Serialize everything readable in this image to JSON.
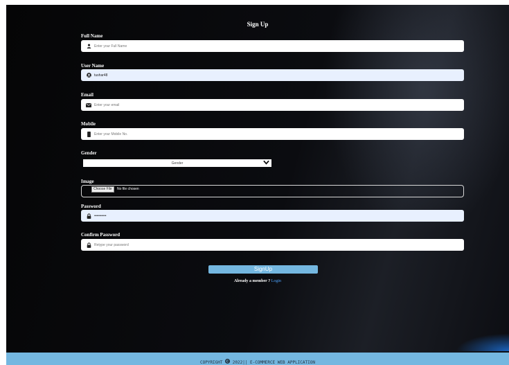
{
  "form": {
    "title": "Sign Up",
    "full_name": {
      "label": "Full Name",
      "placeholder": "Enter your Full Name",
      "value": ""
    },
    "user_name": {
      "label": "User Name",
      "placeholder": "",
      "value": "tushar48"
    },
    "email": {
      "label": "Email",
      "placeholder": "Enter your email",
      "value": ""
    },
    "mobile": {
      "label": "Mobile",
      "placeholder": "Enter your Mobile No.",
      "value": ""
    },
    "gender": {
      "label": "Gender",
      "selected": "Gender"
    },
    "image": {
      "label": "Image",
      "button": "Choose File",
      "status": "No file chosen"
    },
    "password": {
      "label": "Password",
      "placeholder": "",
      "value": "••••••••••"
    },
    "confirm_password": {
      "label": "Confirm Password",
      "placeholder": "Retype your password",
      "value": ""
    },
    "submit_label": "SignUp",
    "member_text": "Already a member ?",
    "login_link": "Login"
  },
  "footer": {
    "prefix": "COPYRIGHT",
    "suffix": "2022|| E-COMMERCE WEB APPLICATION"
  },
  "colors": {
    "accent": "#74b7e0",
    "link": "#4da3ff",
    "autofill": "#e8f0fe"
  }
}
